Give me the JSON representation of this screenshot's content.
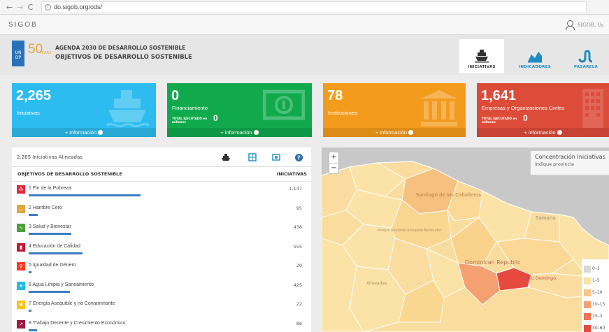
{
  "browser": {
    "url": "do.sigob.org/ods/"
  },
  "app": {
    "title": "SIGOB",
    "user": "SIGOB, Us"
  },
  "header": {
    "logo_text": "UN DP",
    "years_num": "50",
    "years_word": "YEARS",
    "line1": "AGENDA 2030 DE DESARROLLO SOSTENIBLE",
    "line2": "OBJETIVOS DE DESARROLLO SOSTENIBLE",
    "tabs": [
      {
        "label": "INICIATIVAS",
        "icon": "ship-icon",
        "active": true,
        "color": "#333333"
      },
      {
        "label": "INDICADORES",
        "icon": "area-chart-icon",
        "active": false,
        "color": "#1e8bc3"
      },
      {
        "label": "PASARELA",
        "icon": "stepped-line-icon",
        "active": false,
        "color": "#1e8bc3"
      }
    ]
  },
  "cards": {
    "iniciativas": {
      "number": "2,265",
      "label": "Iniciativas",
      "more": "+ información",
      "color": "#2dbcef"
    },
    "financiamiento": {
      "number": "0",
      "label": "Financiamiento",
      "sub": "TOTAL EJECUTADO en millones",
      "sub_value": "0",
      "more": "+ información",
      "color": "#10aa4d"
    },
    "instituciones": {
      "number": "78",
      "label": "Instituciones",
      "more": "+ información",
      "color": "#f39b1d"
    },
    "empresas": {
      "number": "1,641",
      "label": "Empresas y Organizaciones Civiles",
      "sub": "TOTAL EJECUTADO en millones",
      "sub_value": "0",
      "more": "+ información",
      "color": "#dd4b39"
    }
  },
  "panel": {
    "count_text": "2.265 Iniciativas Alineadas",
    "col_objective": "OBJETIVOS DE DESARROLLO SOSTENIBLE",
    "col_initiatives": "INICIATIVAS",
    "max_value": 1147,
    "objectives": [
      {
        "label": "1 Fin de la Pobreza",
        "value": "1.147",
        "num": 1147,
        "color": "#e5243b",
        "icon": "family-icon"
      },
      {
        "label": "2 Hambre Cero",
        "value": "95",
        "num": 95,
        "color": "#dda63a",
        "icon": "bowl-icon"
      },
      {
        "label": "3 Salud y Bienestar",
        "value": "438",
        "num": 438,
        "color": "#4c9f38",
        "icon": "heartbeat-icon"
      },
      {
        "label": "4 Educación de Calidad",
        "value": "555",
        "num": 555,
        "color": "#c5192d",
        "icon": "book-icon"
      },
      {
        "label": "5 Igualdad de Género",
        "value": "20",
        "num": 20,
        "color": "#ff3a21",
        "icon": "gender-icon"
      },
      {
        "label": "6 Agua Limpia y Saneamiento",
        "value": "425",
        "num": 425,
        "color": "#26bde2",
        "icon": "water-icon"
      },
      {
        "label": "7 Energía Asequible y no Contaminante",
        "value": "22",
        "num": 22,
        "color": "#fcc30b",
        "icon": "sun-icon"
      },
      {
        "label": "8 Trabajo Decente y Crecimiento Económico",
        "value": "86",
        "num": 86,
        "color": "#a21942",
        "icon": "growth-icon"
      }
    ]
  },
  "map": {
    "zoom_in": "+",
    "zoom_out": "−",
    "info_title": "Concentración Iniciativas",
    "info_sub": "indique provincia",
    "labels": {
      "santiago": "Santiago de los Caballeros",
      "samana": "Samana",
      "dominican": "Dominican Republic",
      "santo_domingo": "Santo Domingo",
      "parque": "Parque Nacional Armando Bermudez",
      "alineadas": "Alineadas"
    },
    "legend": [
      {
        "label": "0–1",
        "color": "#d9d9d9"
      },
      {
        "label": "1–5",
        "color": "#fbe3a7"
      },
      {
        "label": "5–10",
        "color": "#f8c58a"
      },
      {
        "label": "10–15",
        "color": "#f4a070"
      },
      {
        "label": "15–3",
        "color": "#ee7357"
      },
      {
        "label": "30–60",
        "color": "#e64a3f"
      }
    ]
  }
}
